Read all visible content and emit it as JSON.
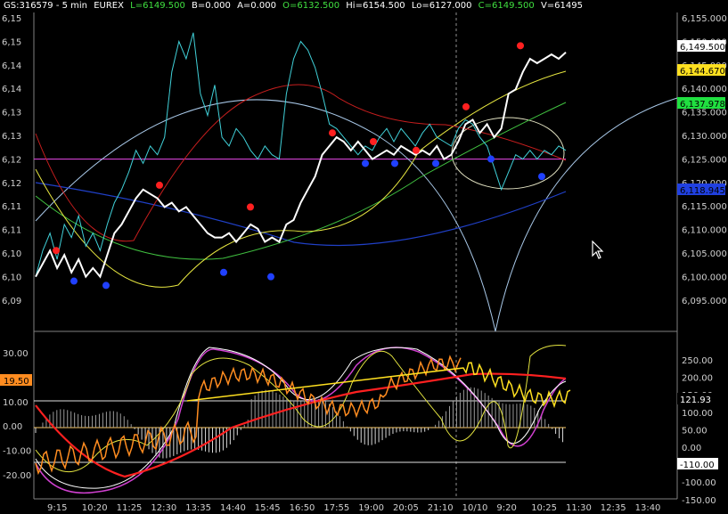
{
  "header": {
    "symbol": "GS:316579 - 5 min",
    "exchange": "EUREX",
    "last": "L=6149.500",
    "bid": "B=0.000",
    "ask": "A=0.000",
    "open": "O=6132.500",
    "high": "Hi=6154.500",
    "low": "Lo=6127.000",
    "close": "C=6149.500",
    "volume": "V=61495"
  },
  "colors": {
    "background": "#000000",
    "price": "#ffffff",
    "fast_line": "#40d0d8",
    "red_ma": "#c81e1e",
    "yellow_ma": "#e6e640",
    "green_ma": "#40c040",
    "blue_ma": "#2040c8",
    "arc": "#a8c8e8",
    "level": "#d040d0",
    "dot_red": "#ff2020",
    "dot_blue": "#2040ff",
    "osc_orange": "#ff8c20",
    "osc_yellow": "#ffe020",
    "osc_red": "#ff2020",
    "osc_magenta": "#d040d0"
  },
  "price_axis": {
    "ticks": [
      "6,155.000",
      "6,150.000",
      "6,145.000",
      "6,140.000",
      "6,135.000",
      "6,130.000",
      "6,125.000",
      "6,120.000",
      "6,115.000",
      "6,110.000",
      "6,105.000",
      "6,100.000",
      "6,095.000"
    ],
    "left_ticks": [
      "6,15",
      "6,15",
      "6,14",
      "6,14",
      "6,13",
      "6,13",
      "6,12",
      "6,12",
      "6,11",
      "6,11",
      "6,10",
      "6,10",
      "6,09"
    ]
  },
  "price_tags": [
    {
      "label": "6,149.500",
      "bg": "#ffffff",
      "fg": "#000000"
    },
    {
      "label": "6,144.670",
      "bg": "#ffe020",
      "fg": "#000000"
    },
    {
      "label": "6,137.978",
      "bg": "#20e040",
      "fg": "#000000"
    },
    {
      "label": "6,118.945",
      "bg": "#2040e0",
      "fg": "#000000"
    }
  ],
  "osc_axis": {
    "left_ticks": [
      "30.00",
      "20.00",
      "10.00",
      "0.00",
      "-10.00",
      "-20.00"
    ],
    "right_ticks": [
      "250.00",
      "200.00",
      "150.00",
      "100.00",
      "50.00",
      "0.00",
      "-50.00",
      "-100.00",
      "-150.00"
    ],
    "left_tag": {
      "label": "19.50",
      "bg": "#ff8c20",
      "fg": "#000000"
    },
    "right_tags": [
      {
        "label": "121.93",
        "bg": "#000000",
        "fg": "#ffffff"
      },
      {
        "label": "-110.00",
        "bg": "#ffffff",
        "fg": "#000000"
      }
    ]
  },
  "time_axis": {
    "ticks": [
      "9:15",
      "10:20",
      "11:25",
      "12:30",
      "13:35",
      "14:40",
      "15:45",
      "16:50",
      "17:55",
      "19:00",
      "20:05",
      "21:10",
      "10/10",
      "9:20",
      "10:25",
      "11:30",
      "12:35",
      "13:40"
    ]
  },
  "chart_data": {
    "type": "line",
    "price_range": [
      6092,
      6157
    ],
    "price_series": [
      6098,
      6101,
      6104,
      6100,
      6103,
      6099,
      6102,
      6098,
      6100,
      6098,
      6103,
      6108,
      6110,
      6113,
      6116,
      6118,
      6117,
      6116,
      6114,
      6115,
      6113,
      6114,
      6112,
      6110,
      6108,
      6107,
      6107,
      6108,
      6106,
      6108,
      6110,
      6109,
      6106,
      6107,
      6106,
      6110,
      6111,
      6115,
      6118,
      6121,
      6126,
      6128,
      6130,
      6129,
      6127,
      6129,
      6127,
      6125,
      6126,
      6127,
      6126,
      6128,
      6127,
      6126,
      6127,
      6126,
      6128,
      6125,
      6126,
      6129,
      6133,
      6134,
      6131,
      6133,
      6130,
      6132,
      6140,
      6141,
      6145,
      6148,
      6147,
      6148,
      6149,
      6148,
      6149.5
    ],
    "oscillator_left_range": [
      -25,
      35
    ],
    "oscillator_right_range": [
      -170,
      300
    ],
    "levels": {
      "horizontal_price": 6125
    },
    "dots_red": [
      6104,
      6119,
      6114,
      6131,
      6129,
      6127,
      6137,
      6151
    ],
    "dots_blue": [
      6097,
      6096,
      6099,
      6098,
      6124,
      6124,
      6124,
      6125,
      6121,
      6141
    ]
  }
}
